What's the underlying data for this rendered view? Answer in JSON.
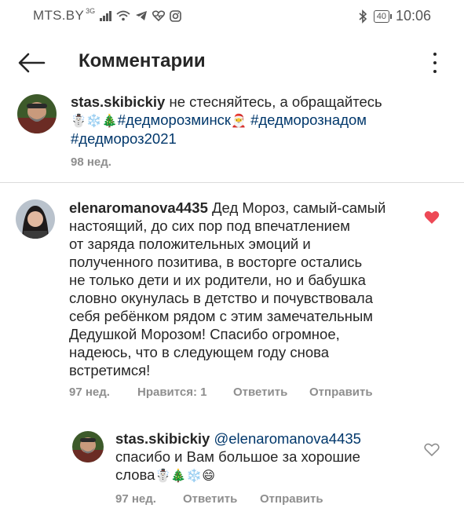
{
  "status_bar": {
    "carrier": "MTS.BY",
    "signal_type": "3G",
    "battery": "40",
    "time": "10:06"
  },
  "header": {
    "title": "Комментарии"
  },
  "caption": {
    "username": "stas.skibickiy",
    "text": " не стесняйтесь, а обращайтесь",
    "emoji1": "☃️❄️🎄",
    "tag1": "#дедморозминск",
    "emoji2": "🎅",
    "tag2": "#дедморознадом",
    "tag3": "#дедмороз2021",
    "time": "98 нед."
  },
  "comments": [
    {
      "username": "elenaromanova4435",
      "lines": [
        " Дед Мороз, самый-самый",
        "настоящий, до сих пор под впечатлением",
        "от заряда положительных эмоций и",
        "полученного позитива, в восторге остались",
        "не только дети и их родители, но и бабушка",
        "словно окунулась в детство и почувствовала",
        "себя ребёнком рядом с этим замечательным",
        "Дедушкой Морозом! Спасибо огромное,",
        "надеюсь, что в следующем году  снова",
        "встретимся!"
      ],
      "time": "97 нед.",
      "likes": "Нравится: 1",
      "reply": "Ответить",
      "send": "Отправить",
      "liked": true,
      "heart_color": "#ed4956"
    }
  ],
  "reply": {
    "username": "stas.skibickiy",
    "mention": "@elenaromanova4435",
    "line2": "спасибо и Вам большое за хорошие",
    "line3": "слова",
    "emoji": "☃️🎄❄️😄",
    "time": "97 нед.",
    "reply": "Ответить",
    "send": "Отправить",
    "liked": false
  }
}
